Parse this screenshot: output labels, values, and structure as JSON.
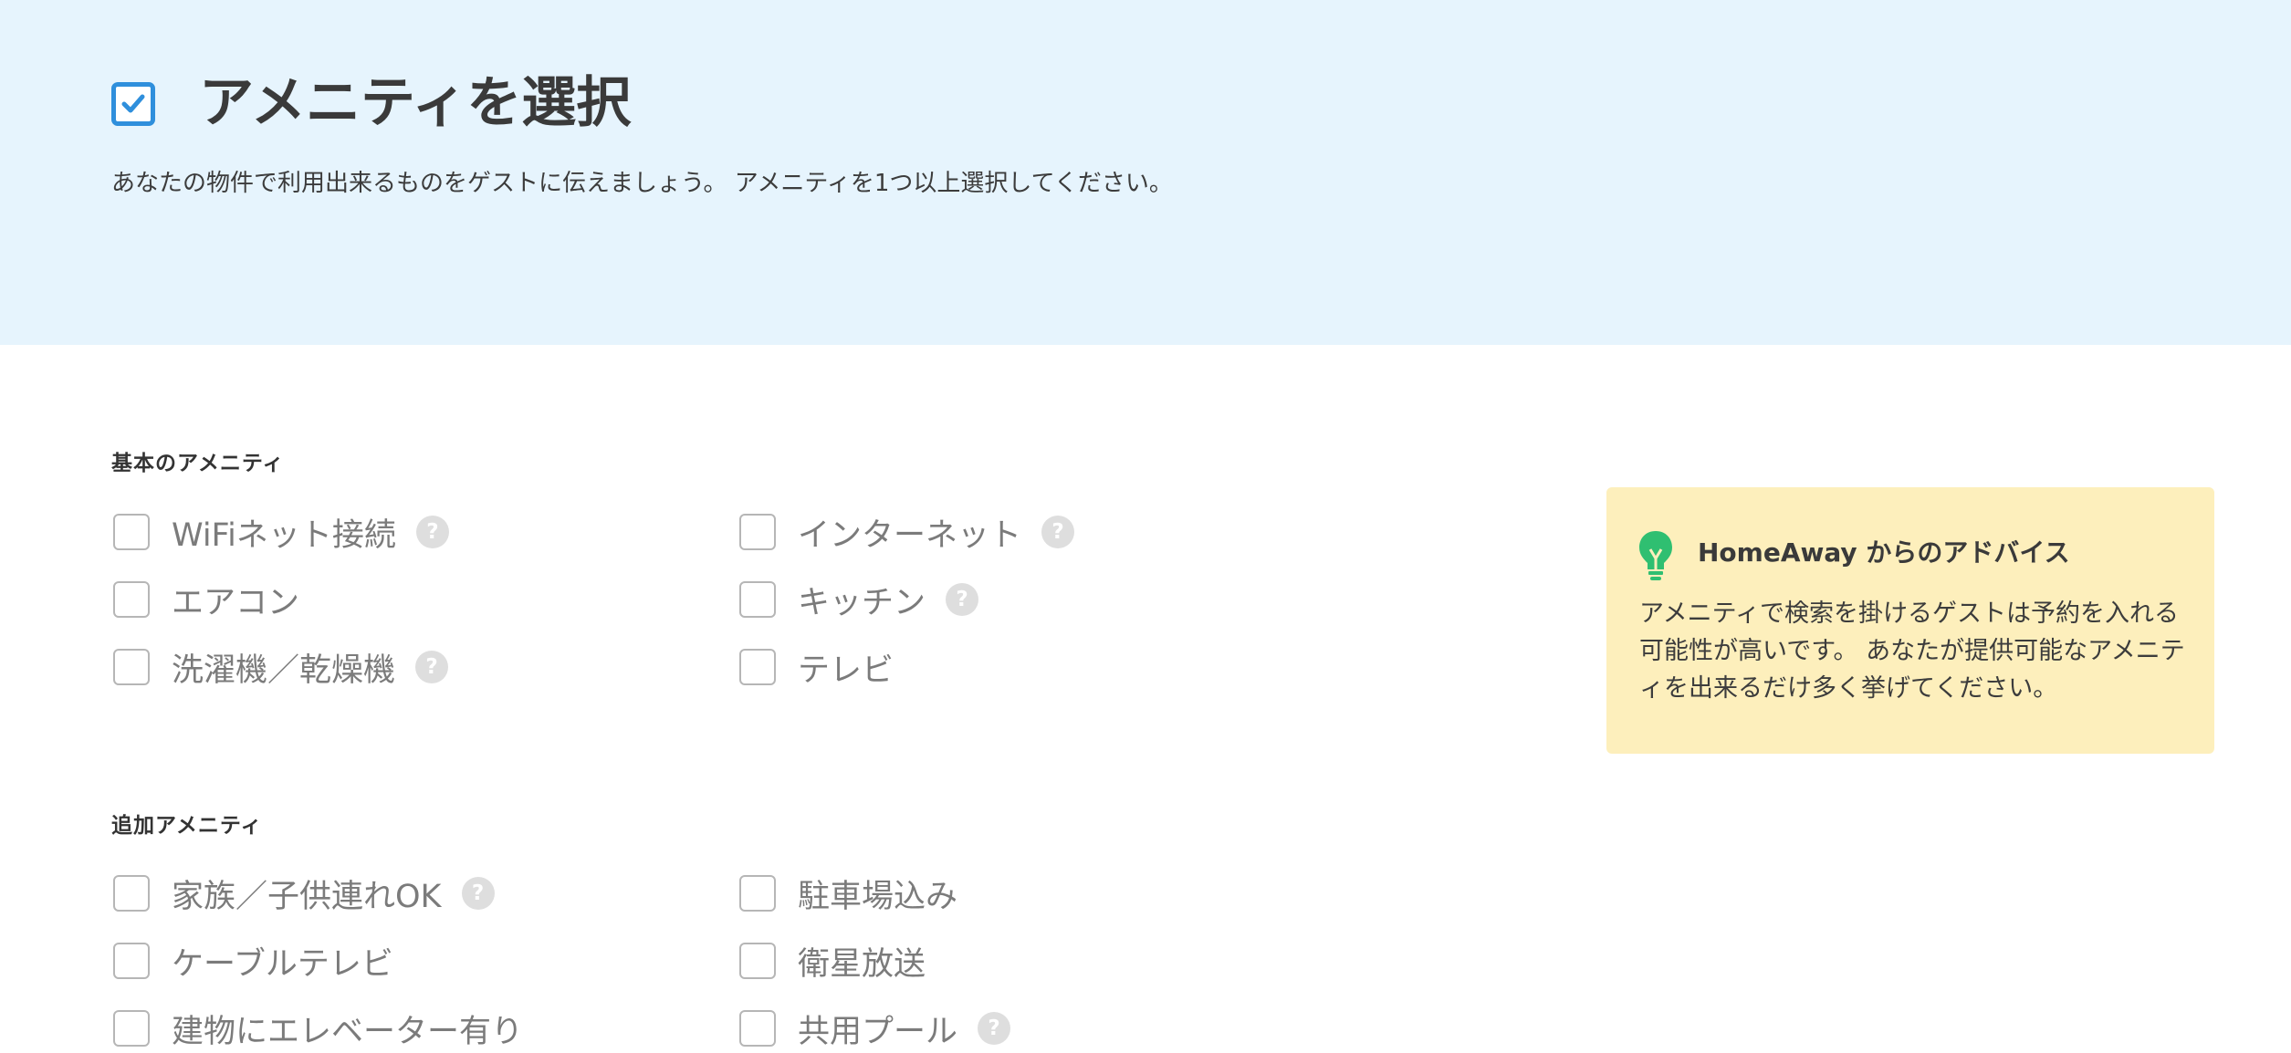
{
  "header": {
    "title": "アメニティを選択",
    "description": "あなたの物件で利用出来るものをゲストに伝えましょう。 アメニティを1つ以上選択してください。"
  },
  "basic": {
    "title": "基本のアメニティ",
    "items": [
      {
        "label": "WiFiネット接続",
        "help": "?",
        "checked": false
      },
      {
        "label": "インターネット",
        "help": "?",
        "checked": false
      },
      {
        "label": "エアコン",
        "checked": false
      },
      {
        "label": "キッチン",
        "help": "?",
        "checked": false
      },
      {
        "label": "洗濯機／乾燥機",
        "help": "?",
        "checked": false
      },
      {
        "label": "テレビ",
        "checked": false
      }
    ]
  },
  "additional": {
    "title": "追加アメニティ",
    "items": [
      {
        "label": "家族／子供連れOK",
        "help": "?",
        "checked": false
      },
      {
        "label": "駐車場込み",
        "checked": false
      },
      {
        "label": "ケーブルテレビ",
        "checked": false
      },
      {
        "label": "衛星放送",
        "checked": false
      },
      {
        "label": "建物にエレベーター有り",
        "checked": false
      },
      {
        "label": "共用プール",
        "help": "?",
        "checked": false
      }
    ]
  },
  "advice": {
    "title": "HomeAway からのアドバイス",
    "text": "アメニティで検索を掛けるゲストは予約を入れる可能性が高いです。 あなたが提供可能なアメニティを出来るだけ多く挙げてください。",
    "icon": "lightbulb-icon"
  },
  "colors": {
    "hero_bg": "#e6f4fd",
    "accent": "#2f8fdc",
    "advice_bg": "#fdefbc",
    "bulb": "#2fbf71"
  }
}
